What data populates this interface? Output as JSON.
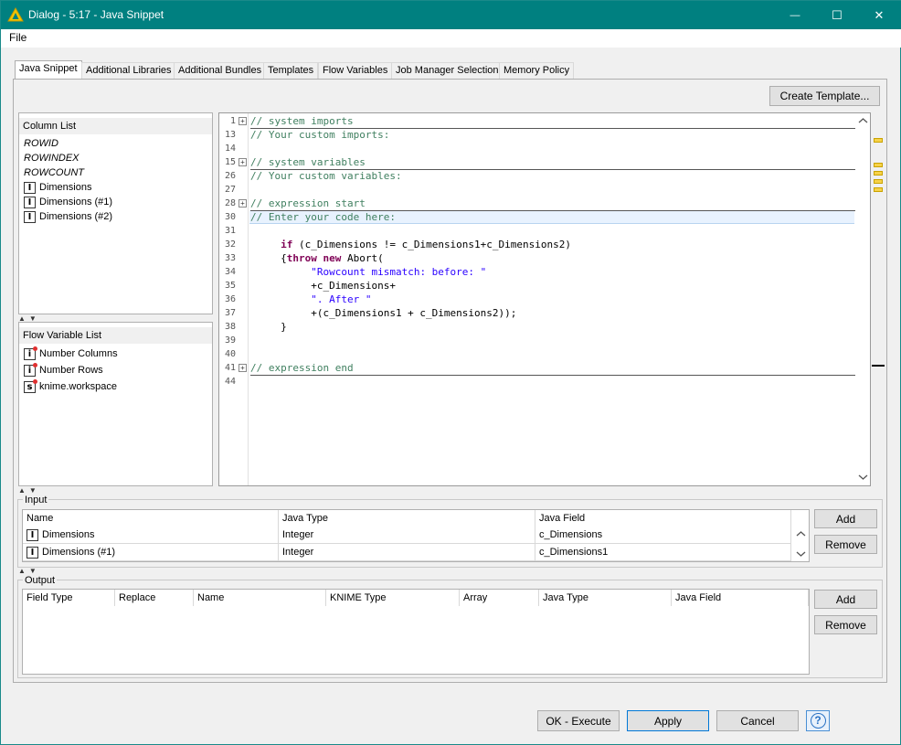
{
  "window": {
    "title": "Dialog - 5:17 - Java Snippet",
    "minimize_glyph": "—",
    "maximize_glyph": "☐",
    "close_glyph": "✕"
  },
  "menu": {
    "file": "File"
  },
  "tabs": [
    {
      "label": "Java Snippet",
      "active": true
    },
    {
      "label": "Additional Libraries"
    },
    {
      "label": "Additional Bundles"
    },
    {
      "label": "Templates"
    },
    {
      "label": "Flow Variables"
    },
    {
      "label": "Job Manager Selection"
    },
    {
      "label": "Memory Policy"
    }
  ],
  "create_template_label": "Create Template...",
  "column_list": {
    "header": "Column List",
    "special_items": [
      "ROWID",
      "ROWINDEX",
      "ROWCOUNT"
    ],
    "columns": [
      {
        "type_icon": "I",
        "name": "Dimensions"
      },
      {
        "type_icon": "I",
        "name": "Dimensions (#1)"
      },
      {
        "type_icon": "I",
        "name": "Dimensions (#2)"
      }
    ]
  },
  "flow_variable_list": {
    "header": "Flow Variable List",
    "items": [
      {
        "type_icon": "i",
        "name": "Number Columns"
      },
      {
        "type_icon": "i",
        "name": "Number Rows"
      },
      {
        "type_icon": "s",
        "name": "knime.workspace"
      }
    ]
  },
  "editor": {
    "lines": [
      {
        "n": "1",
        "fold": "+",
        "text": "// system imports",
        "style": "cm",
        "sep": true
      },
      {
        "n": "13",
        "text": "// Your custom imports:",
        "style": "cm"
      },
      {
        "n": "14",
        "text": ""
      },
      {
        "n": "15",
        "fold": "+",
        "text": "// system variables",
        "style": "cm",
        "sep": true
      },
      {
        "n": "26",
        "text": "// Your custom variables:",
        "style": "cm"
      },
      {
        "n": "27",
        "text": ""
      },
      {
        "n": "28",
        "fold": "+",
        "text": "// expression start",
        "style": "cm",
        "sep": true
      },
      {
        "n": "30",
        "text": "// Enter your code here:",
        "style": "cm",
        "highlight": true
      },
      {
        "n": "31",
        "text": ""
      },
      {
        "n": "32",
        "parts": [
          [
            "",
            "     "
          ],
          [
            "kw",
            "if"
          ],
          [
            "",
            " (c_Dimensions != c_Dimensions1+c_Dimensions2)"
          ]
        ]
      },
      {
        "n": "33",
        "parts": [
          [
            "",
            "     {"
          ],
          [
            "kw",
            "throw"
          ],
          [
            "",
            " "
          ],
          [
            "kw",
            "new"
          ],
          [
            "",
            " Abort("
          ]
        ]
      },
      {
        "n": "34",
        "parts": [
          [
            "",
            "          "
          ],
          [
            "str",
            "\"Rowcount mismatch: before: \""
          ]
        ]
      },
      {
        "n": "35",
        "parts": [
          [
            "",
            "          +c_Dimensions+"
          ]
        ]
      },
      {
        "n": "36",
        "parts": [
          [
            "",
            "          "
          ],
          [
            "str",
            "\". After \""
          ]
        ]
      },
      {
        "n": "37",
        "parts": [
          [
            "",
            "          +(c_Dimensions1 + c_Dimensions2));"
          ]
        ]
      },
      {
        "n": "38",
        "parts": [
          [
            "",
            "     }"
          ]
        ]
      },
      {
        "n": "39",
        "text": ""
      },
      {
        "n": "40",
        "text": ""
      },
      {
        "n": "41",
        "fold": "+",
        "text": "// expression end",
        "style": "cm",
        "sep": true
      },
      {
        "n": "44",
        "text": ""
      }
    ]
  },
  "input": {
    "label": "Input",
    "headers": [
      "Name",
      "Java Type",
      "Java Field"
    ],
    "rows": [
      {
        "type_icon": "I",
        "name": "Dimensions",
        "java_type": "Integer",
        "java_field": "c_Dimensions"
      },
      {
        "type_icon": "I",
        "name": "Dimensions (#1)",
        "java_type": "Integer",
        "java_field": "c_Dimensions1"
      }
    ],
    "add_label": "Add",
    "remove_label": "Remove"
  },
  "output": {
    "label": "Output",
    "headers": [
      "Field Type",
      "Replace",
      "Name",
      "KNIME Type",
      "Array",
      "Java Type",
      "Java Field"
    ],
    "add_label": "Add",
    "remove_label": "Remove"
  },
  "footer": {
    "ok_label": "OK - Execute",
    "apply_label": "Apply",
    "cancel_label": "Cancel",
    "help_glyph": "?"
  },
  "colors": {
    "titlebar": "#008080",
    "comment": "#3f7f5f",
    "keyword": "#7f0055",
    "string": "#2a00ff",
    "highlight_line": "#e8f2fe"
  }
}
